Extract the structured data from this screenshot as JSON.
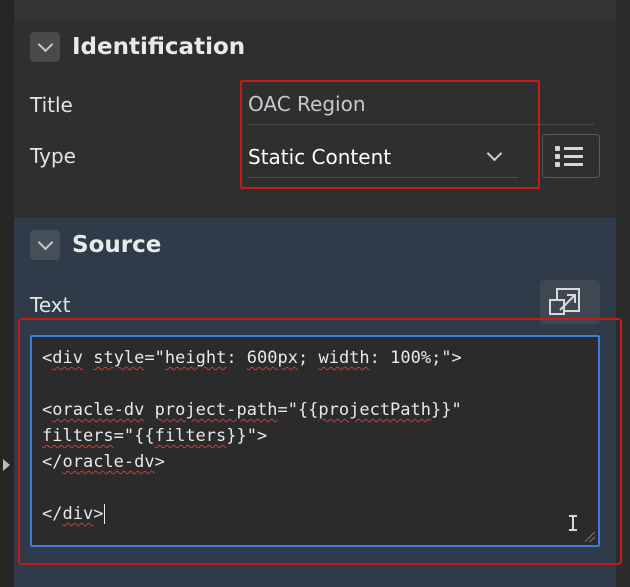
{
  "identification": {
    "section_title": "Identification",
    "title_label": "Title",
    "title_value": "OAC Region",
    "type_label": "Type",
    "type_value": "Static Content"
  },
  "source": {
    "section_title": "Source",
    "text_label": "Text",
    "code": {
      "line1": "<div style=\"height: 600px; width: 100%;\">",
      "line2": "",
      "line3": "<oracle-dv project-path=\"{{projectPath}}\"",
      "line4": "filters=\"{{filters}}\">",
      "line5": "</oracle-dv>",
      "line6": "",
      "line7": "</div>"
    }
  },
  "colors": {
    "highlight": "#c91a1a",
    "editor_focus": "#3b7dd8",
    "source_bg": "#2f3b49"
  },
  "icons": [
    "chevron-down-icon",
    "list-icon",
    "expand-icon",
    "resize-handle-icon",
    "text-cursor-icon"
  ]
}
